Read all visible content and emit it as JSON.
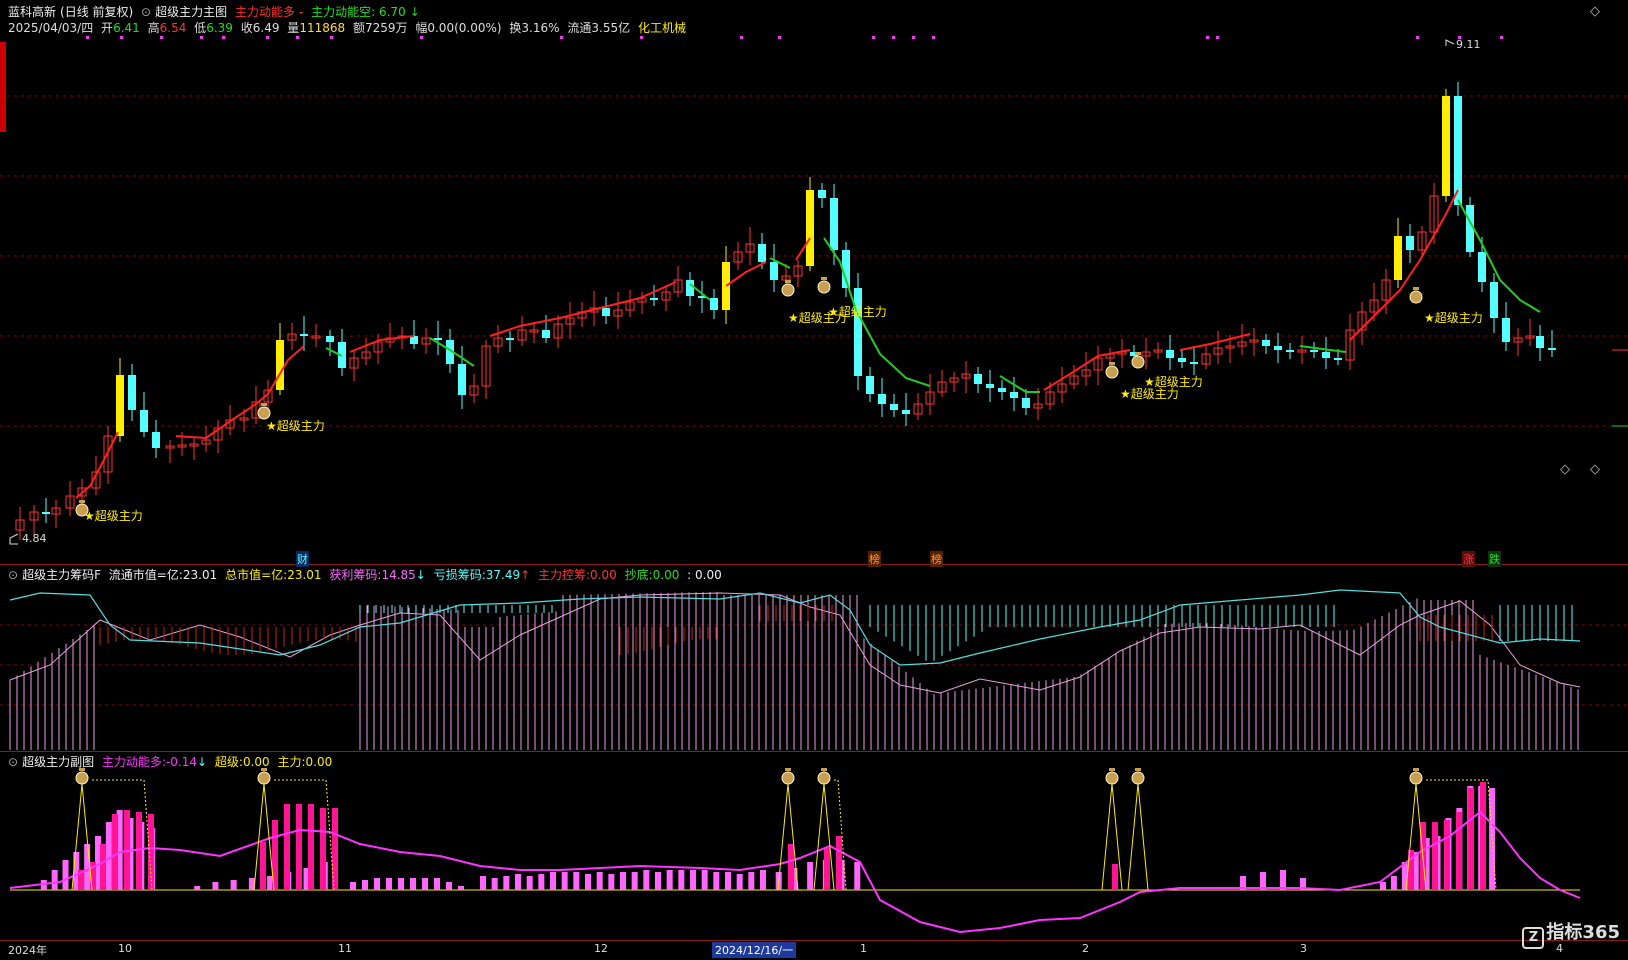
{
  "main": {
    "stock_name": "蓝科高新",
    "period": "(日线 前复权)",
    "indicator": "超级主力主图",
    "legend_up": "主力动能多",
    "legend_dash": "-",
    "legend_down": "主力动能空: 6.70",
    "legend_arrow": "↓",
    "date": "2025/04/03/四",
    "open_label": "开",
    "open": "6.41",
    "high_label": "高",
    "high": "6.54",
    "low_label": "低",
    "low": "6.39",
    "close_label": "收",
    "close": "6.49",
    "vol_label": "量",
    "vol": "111868",
    "amt_label": "额",
    "amt": "7259万",
    "pct_label": "幅",
    "pct": "0.00(0.00%)",
    "turn_label": "换",
    "turn": "3.16%",
    "float_label": "流通",
    "float": "3.55亿",
    "sector": "化工机械",
    "low_mark": "4.84",
    "high_mark": "9.11",
    "signal_label": "★超级主力",
    "bottom_markers": [
      "财",
      "榜",
      "榜",
      "涨",
      "跌"
    ],
    "icons": [
      "money-bag-icon",
      "diamond-icon"
    ]
  },
  "chip": {
    "title": "超级主力筹码F",
    "float_cap_label": "流通市值=亿:",
    "float_cap": "23.01",
    "total_cap_label": "总市值=亿:",
    "total_cap": "23.01",
    "profit_label": "获利筹码:",
    "profit": "14.85",
    "profit_arrow": "↓",
    "loss_label": "亏损筹码:",
    "loss": "37.49",
    "loss_arrow": "↑",
    "control_label": "主力控筹:",
    "control": "0.00",
    "bottom_label": "抄底:",
    "bottom": "0.00",
    "extra": ": 0.00"
  },
  "sub": {
    "title": "超级主力副图",
    "energy_label": "主力动能多:",
    "energy": "-0.14",
    "energy_arrow": "↓",
    "super_label": "超级:",
    "super": "0.00",
    "main_label": "主力:",
    "main": "0.00"
  },
  "axis": {
    "labels": [
      "2024年",
      "10",
      "11",
      "12",
      "2024/12/16/一",
      "1",
      "2",
      "3",
      "4"
    ]
  },
  "brand": {
    "name": "指标365",
    "mark": "Z"
  },
  "colors": {
    "up": "#ff3333",
    "down": "#54ffff",
    "ma_up": "#ff2020",
    "ma_down": "#22cc22",
    "yellow": "#ffee00",
    "magenta": "#ff33ff",
    "pink": "#ff1493",
    "grid": "#8b0000"
  }
}
